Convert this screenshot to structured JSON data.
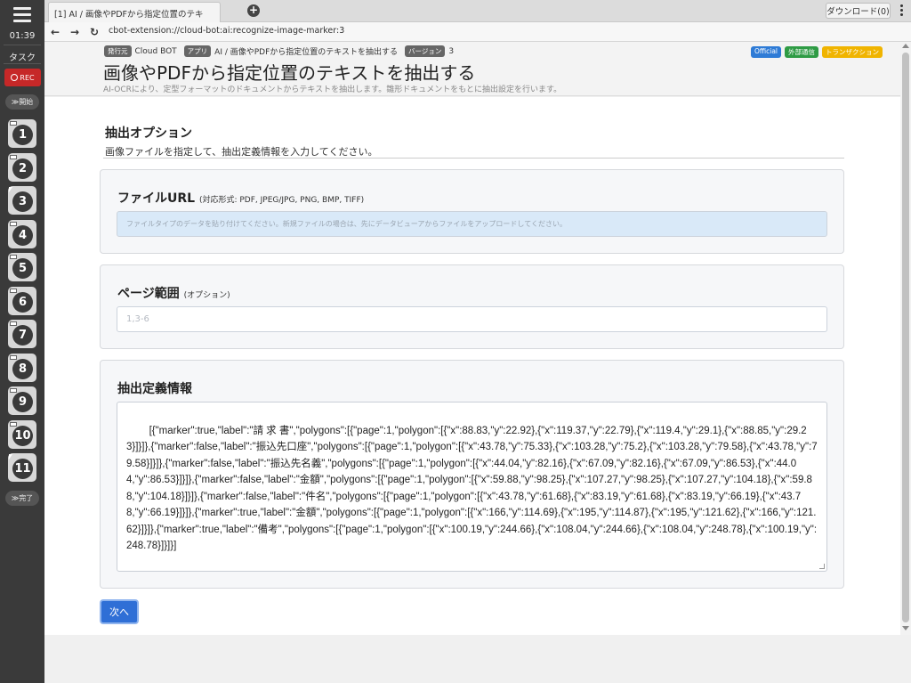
{
  "sidebar": {
    "clock": "01:39",
    "task_label": "タスク",
    "rec_label": "REC",
    "start_label": "開始",
    "finish_label": "完了",
    "steps": [
      "1",
      "2",
      "3",
      "4",
      "5",
      "6",
      "7",
      "8",
      "9",
      "10",
      "11"
    ]
  },
  "browser": {
    "tab_title": "[1] AI / 画像やPDFから指定位置のテキ",
    "download_label": "ダウンロード(0)",
    "url": "cbot-extension://cloud-bot:ai:recognize-image-marker:3"
  },
  "header": {
    "publisher_chip": "発行元",
    "publisher": "Cloud BOT",
    "app_chip": "アプリ",
    "app_path": "AI / 画像やPDFから指定位置のテキストを抽出する",
    "version_chip": "バージョン",
    "version": "3",
    "badges": [
      {
        "label": "Official",
        "color": "#2e7bd6"
      },
      {
        "label": "外部通信",
        "color": "#2e9b44"
      },
      {
        "label": "トランザクション",
        "color": "#f0b400"
      }
    ],
    "title": "画像やPDFから指定位置のテキストを抽出する",
    "description": "AI-OCRにより、定型フォーマットのドキュメントからテキストを抽出します。雛形ドキュメントをもとに抽出設定を行います。"
  },
  "section": {
    "title": "抽出オプション",
    "description": "画像ファイルを指定して、抽出定義情報を入力してください。"
  },
  "file_card": {
    "title": "ファイルURL",
    "subtitle": "(対応形式: PDF, JPEG/JPG, PNG, BMP, TIFF)",
    "placeholder": "ファイルタイプのデータを貼り付けてください。新規ファイルの場合は、先にデータビューアからファイルをアップロードしてください。"
  },
  "page_card": {
    "title": "ページ範囲",
    "subtitle": "(オプション)",
    "placeholder": "1,3-6"
  },
  "def_card": {
    "title": "抽出定義情報",
    "value": "[{\"marker\":true,\"label\":\"請 求 書\",\"polygons\":[{\"page\":1,\"polygon\":[{\"x\":88.83,\"y\":22.92},{\"x\":119.37,\"y\":22.79},{\"x\":119.4,\"y\":29.1},{\"x\":88.85,\"y\":29.23}]}]},{\"marker\":false,\"label\":\"振込先口座\",\"polygons\":[{\"page\":1,\"polygon\":[{\"x\":43.78,\"y\":75.33},{\"x\":103.28,\"y\":75.2},{\"x\":103.28,\"y\":79.58},{\"x\":43.78,\"y\":79.58}]}]},{\"marker\":false,\"label\":\"振込先名義\",\"polygons\":[{\"page\":1,\"polygon\":[{\"x\":44.04,\"y\":82.16},{\"x\":67.09,\"y\":82.16},{\"x\":67.09,\"y\":86.53},{\"x\":44.04,\"y\":86.53}]}]},{\"marker\":false,\"label\":\"金額\",\"polygons\":[{\"page\":1,\"polygon\":[{\"x\":59.88,\"y\":98.25},{\"x\":107.27,\"y\":98.25},{\"x\":107.27,\"y\":104.18},{\"x\":59.88,\"y\":104.18}]}]},{\"marker\":false,\"label\":\"件名\",\"polygons\":[{\"page\":1,\"polygon\":[{\"x\":43.78,\"y\":61.68},{\"x\":83.19,\"y\":61.68},{\"x\":83.19,\"y\":66.19},{\"x\":43.78,\"y\":66.19}]}]},{\"marker\":true,\"label\":\"金額\",\"polygons\":[{\"page\":1,\"polygon\":[{\"x\":166,\"y\":114.69},{\"x\":195,\"y\":114.87},{\"x\":195,\"y\":121.62},{\"x\":166,\"y\":121.62}]}]},{\"marker\":true,\"label\":\"備考\",\"polygons\":[{\"page\":1,\"polygon\":[{\"x\":100.19,\"y\":244.66},{\"x\":108.04,\"y\":244.66},{\"x\":108.04,\"y\":248.78},{\"x\":100.19,\"y\":248.78}]}]}]"
  },
  "next_label": "次へ"
}
